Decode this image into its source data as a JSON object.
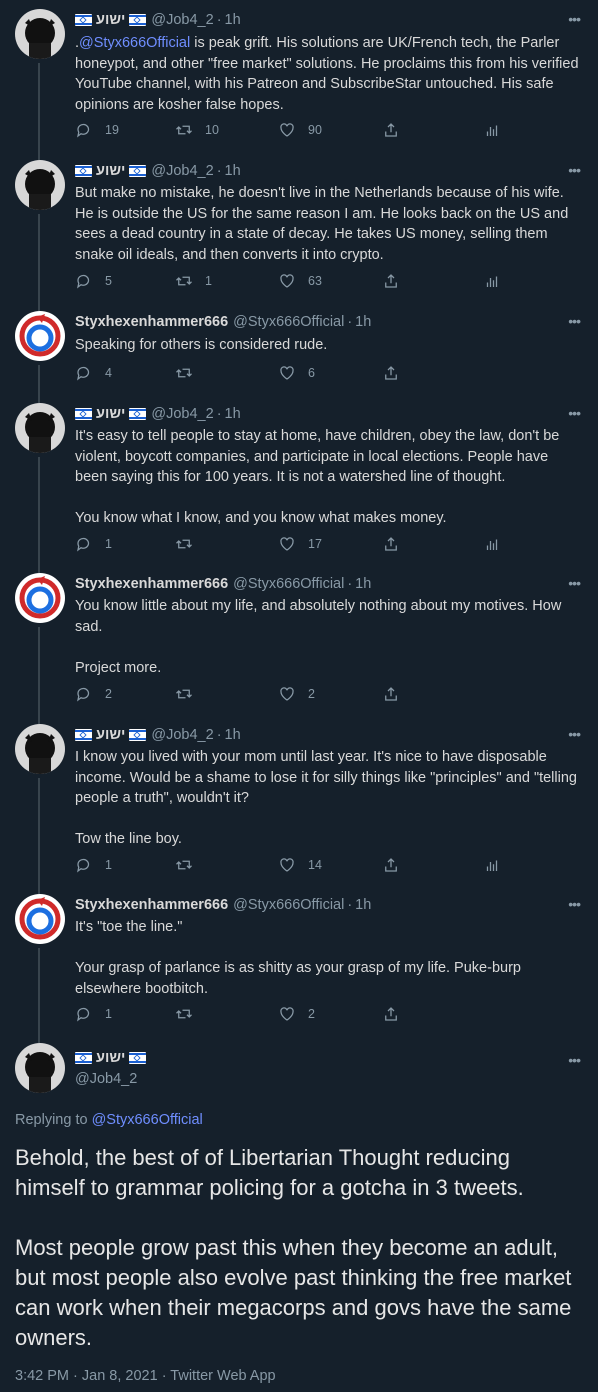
{
  "users": {
    "job": {
      "name_hebrew": "ישוע",
      "handle": "@Job4_2"
    },
    "styx": {
      "name": "Styxhexenhammer666",
      "handle": "@Styx666Official"
    }
  },
  "tweets": [
    {
      "author": "job",
      "time": "1h",
      "paragraphs": [
        ".@Styx666Official is peak grift. His solutions are UK/French tech, the Parler honeypot, and other \"free market\" solutions. He proclaims this from his verified YouTube channel, with his Patreon and SubscribeStar untouched. His safe opinions are kosher false hopes."
      ],
      "mention_prefix": ".",
      "mention": "@Styx666Official",
      "rest": " is peak grift. His solutions are UK/French tech, the Parler honeypot, and other \"free market\" solutions. He proclaims this from his verified YouTube channel, with his Patreon and SubscribeStar untouched. His safe opinions are kosher false hopes.",
      "replies": "19",
      "retweets": "10",
      "likes": "90"
    },
    {
      "author": "job",
      "time": "1h",
      "paragraphs": [
        "But make no mistake, he doesn't live in the Netherlands because of his wife. He is outside the US for the same reason I am. He looks back on the US and sees a dead country in a state of decay. He takes US money, selling them snake oil ideals, and then converts it into crypto."
      ],
      "replies": "5",
      "retweets": "1",
      "likes": "63"
    },
    {
      "author": "styx",
      "time": "1h",
      "paragraphs": [
        "Speaking for others is considered rude."
      ],
      "replies": "4",
      "retweets": "",
      "likes": "6"
    },
    {
      "author": "job",
      "time": "1h",
      "paragraphs": [
        "It's easy to tell people to stay at home, have children, obey the law, don't be violent, boycott companies, and participate in local elections. People have been saying this for 100 years. It is not a watershed line of thought.",
        "You know what I know, and you know what makes money."
      ],
      "replies": "1",
      "retweets": "",
      "likes": "17"
    },
    {
      "author": "styx",
      "time": "1h",
      "paragraphs": [
        "You know little about my life, and absolutely nothing about my motives. How sad.",
        "Project more."
      ],
      "replies": "2",
      "retweets": "",
      "likes": "2"
    },
    {
      "author": "job",
      "time": "1h",
      "paragraphs": [
        "I know you lived with your mom until last year. It's nice to have disposable income. Would be a shame to lose it for silly things like \"principles\" and \"telling people a truth\", wouldn't it?",
        "Tow the line boy."
      ],
      "replies": "1",
      "retweets": "",
      "likes": "14"
    },
    {
      "author": "styx",
      "time": "1h",
      "paragraphs": [
        "It's \"toe the line.\"",
        "Your grasp of parlance is as shitty as your grasp of my life. Puke-burp elsewhere bootbitch."
      ],
      "replies": "1",
      "retweets": "",
      "likes": "2"
    }
  ],
  "main_tweet": {
    "replying_label": "Replying to",
    "replying_to": "@Styx666Official",
    "paragraphs": [
      "Behold, the best of of Libertarian Thought reducing himself to grammar policing for a gotcha in 3 tweets.",
      "Most people grow past this when they become an adult, but most people also evolve past thinking the free market can work when their megacorps and govs have the same owners."
    ],
    "timestamp": "3:42 PM · Jan 8, 2021 · Twitter Web App"
  },
  "separator": "·",
  "more_glyph": "•••",
  "colors": {
    "background": "#15202b",
    "link": "#6f8eff",
    "muted": "#8899a6",
    "text": "#d9d9d9"
  }
}
